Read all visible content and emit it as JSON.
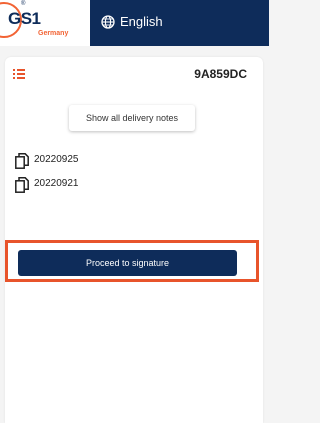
{
  "header": {
    "logo": {
      "brand": "GS1",
      "registered": "®",
      "country": "Germany"
    },
    "language": {
      "icon": "globe-icon",
      "label": "English"
    }
  },
  "card": {
    "menu_icon": "list-icon",
    "document_id": "9A859DC",
    "show_all_label": "Show all delivery notes",
    "delivery_notes": [
      {
        "icon": "copy-icon",
        "label": "20220925"
      },
      {
        "icon": "copy-icon",
        "label": "20220921"
      }
    ],
    "proceed_label": "Proceed to signature"
  },
  "colors": {
    "brand_navy": "#0e2c5a",
    "brand_orange": "#f26334",
    "highlight": "#e8542b"
  }
}
